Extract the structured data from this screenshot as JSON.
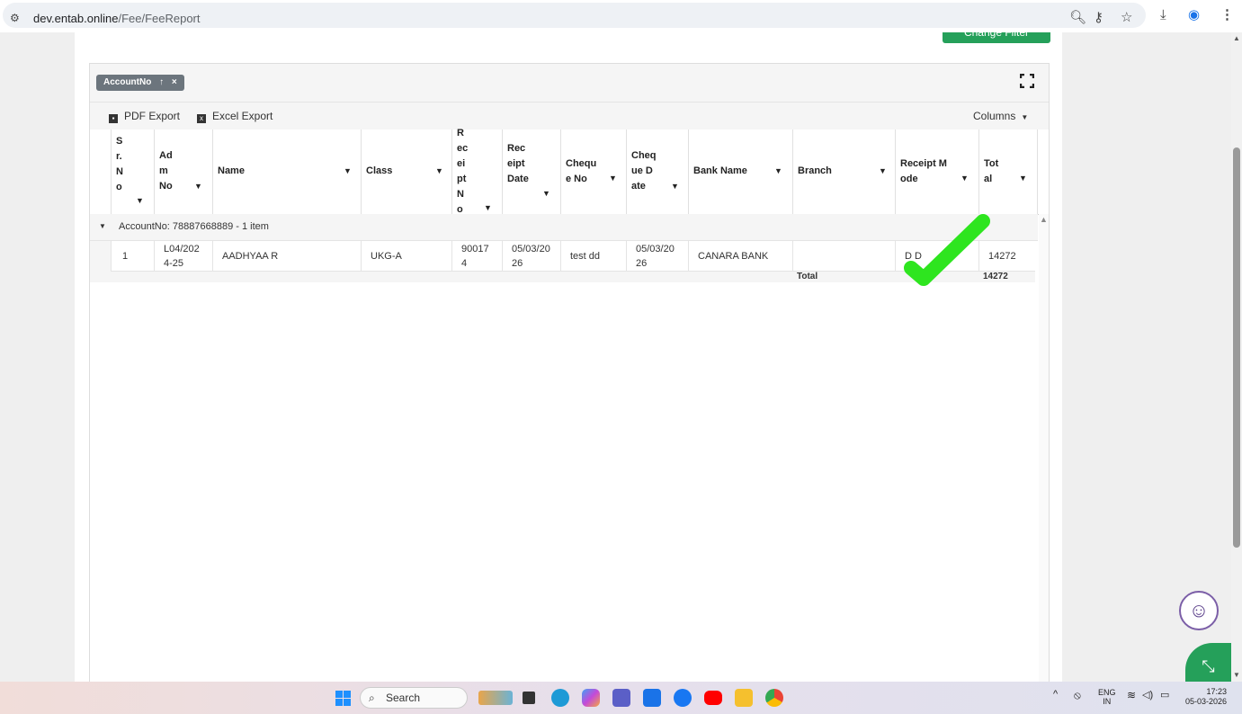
{
  "browser": {
    "url_host": "dev.entab.online",
    "url_path": "/Fee/FeeReport"
  },
  "header_button": {
    "label": "Change Filter"
  },
  "grid": {
    "group_chip": {
      "label": "AccountNo",
      "sort_icon": "arrow-up-icon",
      "remove_icon": "close-icon"
    },
    "toolbar": {
      "pdf_label": "PDF Export",
      "excel_label": "Excel Export",
      "columns_label": "Columns"
    },
    "columns": [
      {
        "label": "Sr.No"
      },
      {
        "label": "Adm No"
      },
      {
        "label": "Name"
      },
      {
        "label": "Class"
      },
      {
        "label": "Receipt No"
      },
      {
        "label": "Receipt Date"
      },
      {
        "label": "Cheque No"
      },
      {
        "label": "Cheque Date"
      },
      {
        "label": "Bank Name"
      },
      {
        "label": "Branch"
      },
      {
        "label": "Receipt Mode"
      },
      {
        "label": "Total"
      }
    ],
    "group_row": {
      "label": "AccountNo: 78887668889 - 1 item"
    },
    "rows": [
      {
        "sr_no": "1",
        "adm_no": "L04/2024-25",
        "name": "AADHYAA R",
        "class": "UKG-A",
        "receipt_no": "900174",
        "receipt_date": "05/03/2026",
        "cheque_no": "test dd",
        "cheque_date": "05/03/2026",
        "bank_name": "CANARA BANK",
        "branch": "",
        "receipt_mode": "D D",
        "total": "14272"
      }
    ],
    "footer": {
      "total_label": "Total",
      "total_value": "14272"
    }
  },
  "taskbar": {
    "search_label": "Search",
    "lang_top": "ENG",
    "lang_bottom": "IN",
    "time": "17:23",
    "date": "05-03-2026"
  },
  "colors": {
    "accent_green": "#25a05a",
    "chip_gray": "#6c757d",
    "check_green": "#2ee51f"
  }
}
